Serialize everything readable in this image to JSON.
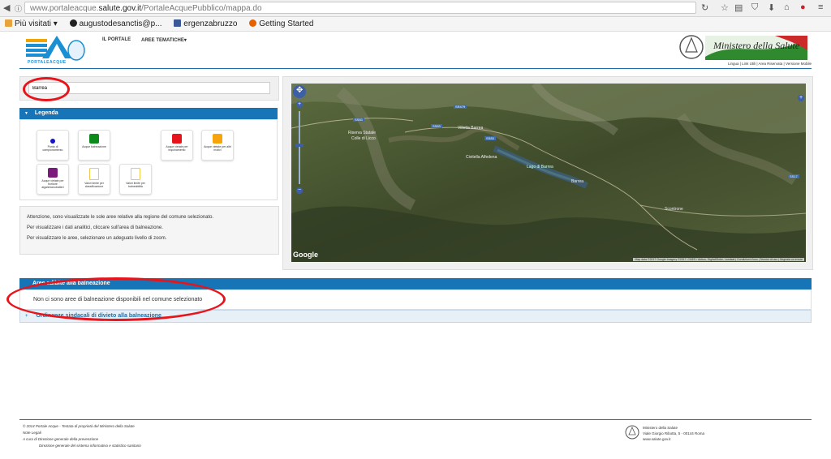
{
  "browser": {
    "url_prefix": "www.portaleacque.",
    "url_domain": "salute.gov.it",
    "url_path": "/PortaleAcquePubblico/mappa.do",
    "bookmarks": [
      {
        "label": "Più visitati ▾",
        "color": "#e8a33a"
      },
      {
        "label": "augustodesanctis@p...",
        "color": "#222222"
      },
      {
        "label": "ergenzabruzzo",
        "color": "#3b5998"
      },
      {
        "label": "Getting Started",
        "color": "#e66000"
      }
    ]
  },
  "header": {
    "logo_text": "PORTALEACQUE",
    "menu": [
      "IL PORTALE",
      "AREE TEMATICHE▾"
    ],
    "ministry": "Ministero della Salute",
    "top_links": "Lingua | Link Utili | Area Riservata | Versione Mobile"
  },
  "search": {
    "value": "Barrea"
  },
  "legend": {
    "title": "Legenda",
    "items": [
      {
        "label": "Punto di campionamento",
        "color": "#1414c8",
        "shape": "dot"
      },
      {
        "label": "Acque balneazione",
        "color": "#0c8a1c",
        "shape": "square"
      },
      {
        "label": "Acque vietate per inquinamento",
        "color": "#e8141b",
        "shape": "square"
      },
      {
        "label": "Acque vietate per altri motivi",
        "color": "#f7a30b",
        "shape": "square"
      },
      {
        "label": "Acque vietate per fioriture algali/cianobatteri",
        "color": "#7a1a7a",
        "shape": "square"
      },
      {
        "label": "Valori limite per classificazione",
        "color": "#f2c94c",
        "shape": "doc"
      },
      {
        "label": "Valori limite per balneabilità",
        "color": "#f2c94c",
        "shape": "doc"
      }
    ]
  },
  "info": {
    "line1": "Attenzione, sono visualizzate le sole aree relative alla regione del comune selezionato.",
    "line2": "Per visualizzare i dati analitici, cliccare sull'area di balneazione.",
    "line3": "Per visualizzare le aree, selezionare un adeguato livello di zoom."
  },
  "map": {
    "labels": [
      "Riserva Statale",
      "Colle di Licco",
      "Villetta Barrea",
      "Civitella Alfedena",
      "Lago di Barrea",
      "Barrea",
      "Scontrone"
    ],
    "roads": [
      "SS83",
      "SS83",
      "SS83",
      "SR479",
      "SS17"
    ],
    "google": "Google",
    "attribution": "Map data ©2017 Google Imagery ©2017, CNES / Airbus, DigitalGlobe, Landsat | Condizioni d'uso | Termini di uso | Segnala un errore"
  },
  "results": {
    "title": "Aree adibite alla balneazione",
    "message": "Non ci sono aree di balneazione disponibili nel comune selezionato",
    "ordinanze": "Ordinanze sindacali di divieto alla balneazione"
  },
  "footer": {
    "line1": "© 2014 Portale Acque - Testata di proprietà del Ministero della Salute",
    "line2": "Note Legali",
    "line3": "A cura di Direzione generale della prevenzione",
    "line4": "Direzione generale del sistema informativo e statistico sanitario",
    "addr1": "Ministero della Salute",
    "addr2": "Viale Giorgio Ribotta, 5 - 00144 Roma",
    "addr3": "www.salute.gov.it"
  }
}
